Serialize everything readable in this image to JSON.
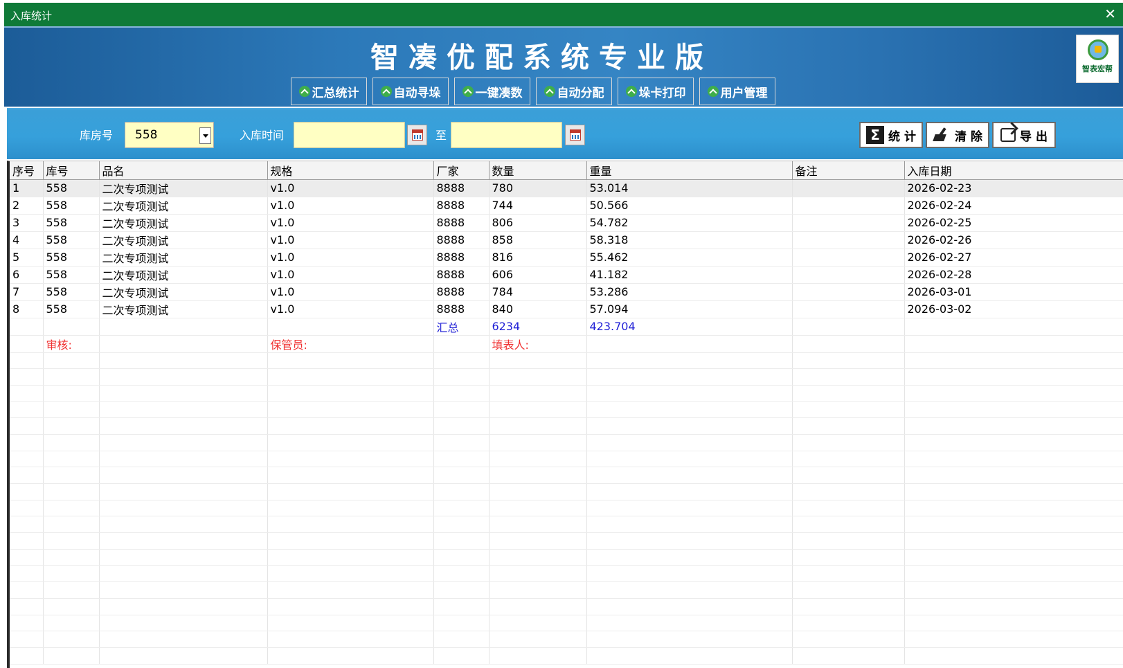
{
  "window": {
    "title": "入库统计",
    "close_glyph": "✕"
  },
  "banner": {
    "app_title": "智凑优配系统专业版",
    "nav": [
      "汇总统计",
      "自动寻垛",
      "一键凑数",
      "自动分配",
      "垛卡打印",
      "用户管理"
    ],
    "logo_text": "智表宏帮"
  },
  "filter": {
    "warehouse_label": "库房号",
    "warehouse_value": "558",
    "date_label": "入库时间",
    "date_from": "",
    "date_to": "",
    "to_label": "至",
    "btn_stat": "统 计",
    "btn_clear": "清 除",
    "btn_export": "导 出"
  },
  "table": {
    "columns": [
      "序号",
      "库号",
      "品名",
      "规格",
      "厂家",
      "数量",
      "重量",
      "备注",
      "入库日期"
    ],
    "rows": [
      [
        "1",
        "558",
        "二次专项测试",
        "v1.0",
        "8888",
        "780",
        "53.014",
        "",
        "2026-02-23"
      ],
      [
        "2",
        "558",
        "二次专项测试",
        "v1.0",
        "8888",
        "744",
        "50.566",
        "",
        "2026-02-24"
      ],
      [
        "3",
        "558",
        "二次专项测试",
        "v1.0",
        "8888",
        "806",
        "54.782",
        "",
        "2026-02-25"
      ],
      [
        "4",
        "558",
        "二次专项测试",
        "v1.0",
        "8888",
        "858",
        "58.318",
        "",
        "2026-02-26"
      ],
      [
        "5",
        "558",
        "二次专项测试",
        "v1.0",
        "8888",
        "816",
        "55.462",
        "",
        "2026-02-27"
      ],
      [
        "6",
        "558",
        "二次专项测试",
        "v1.0",
        "8888",
        "606",
        "41.182",
        "",
        "2026-02-28"
      ],
      [
        "7",
        "558",
        "二次专项测试",
        "v1.0",
        "8888",
        "784",
        "53.286",
        "",
        "2026-03-01"
      ],
      [
        "8",
        "558",
        "二次专项测试",
        "v1.0",
        "8888",
        "840",
        "57.094",
        "",
        "2026-03-02"
      ]
    ],
    "summary": {
      "label": "汇总",
      "quantity": "6234",
      "weight": "423.704"
    },
    "signatures": {
      "review": "审核:",
      "keeper": "保管员:",
      "filler": "填表人:"
    }
  },
  "colors": {
    "titlebar": "#0f7a38",
    "banner": "#2c79b9",
    "filterbar": "#36a0db",
    "input_bg": "#ffffc3",
    "sum": "#1f1fd6",
    "sig": "#f03030"
  }
}
